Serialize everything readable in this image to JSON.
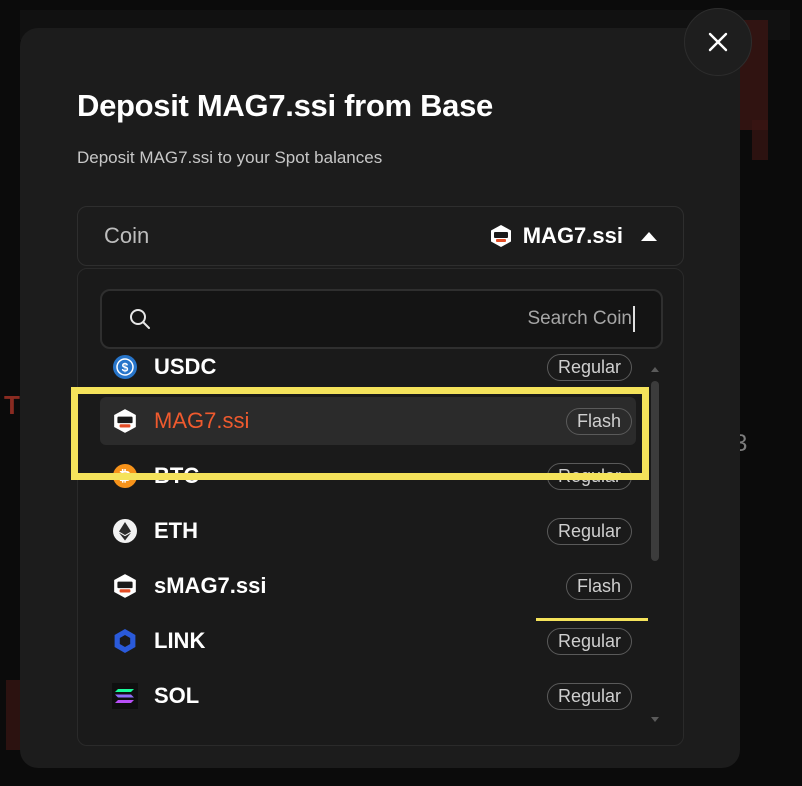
{
  "modal": {
    "title": "Deposit MAG7.ssi from Base",
    "subtitle": "Deposit MAG7.ssi to your Spot balances"
  },
  "coin_select": {
    "label": "Coin",
    "selected": "MAG7.ssi"
  },
  "search": {
    "placeholder": "Search Coin",
    "value": ""
  },
  "coins": [
    {
      "name": "USDC",
      "badge": "Regular",
      "icon": "usdc-icon"
    },
    {
      "name": "MAG7.ssi",
      "badge": "Flash",
      "icon": "ssi-icon"
    },
    {
      "name": "BTC",
      "badge": "Regular",
      "icon": "btc-icon"
    },
    {
      "name": "ETH",
      "badge": "Regular",
      "icon": "eth-icon"
    },
    {
      "name": "sMAG7.ssi",
      "badge": "Flash",
      "icon": "ssi-icon"
    },
    {
      "name": "LINK",
      "badge": "Regular",
      "icon": "link-icon"
    },
    {
      "name": "SOL",
      "badge": "Regular",
      "icon": "sol-icon"
    }
  ],
  "colors": {
    "accent_selected": "#ef5a2e",
    "highlight": "#f5e35b",
    "usdc": "#2775ca",
    "btc": "#f7931a",
    "link": "#2a5ada"
  }
}
